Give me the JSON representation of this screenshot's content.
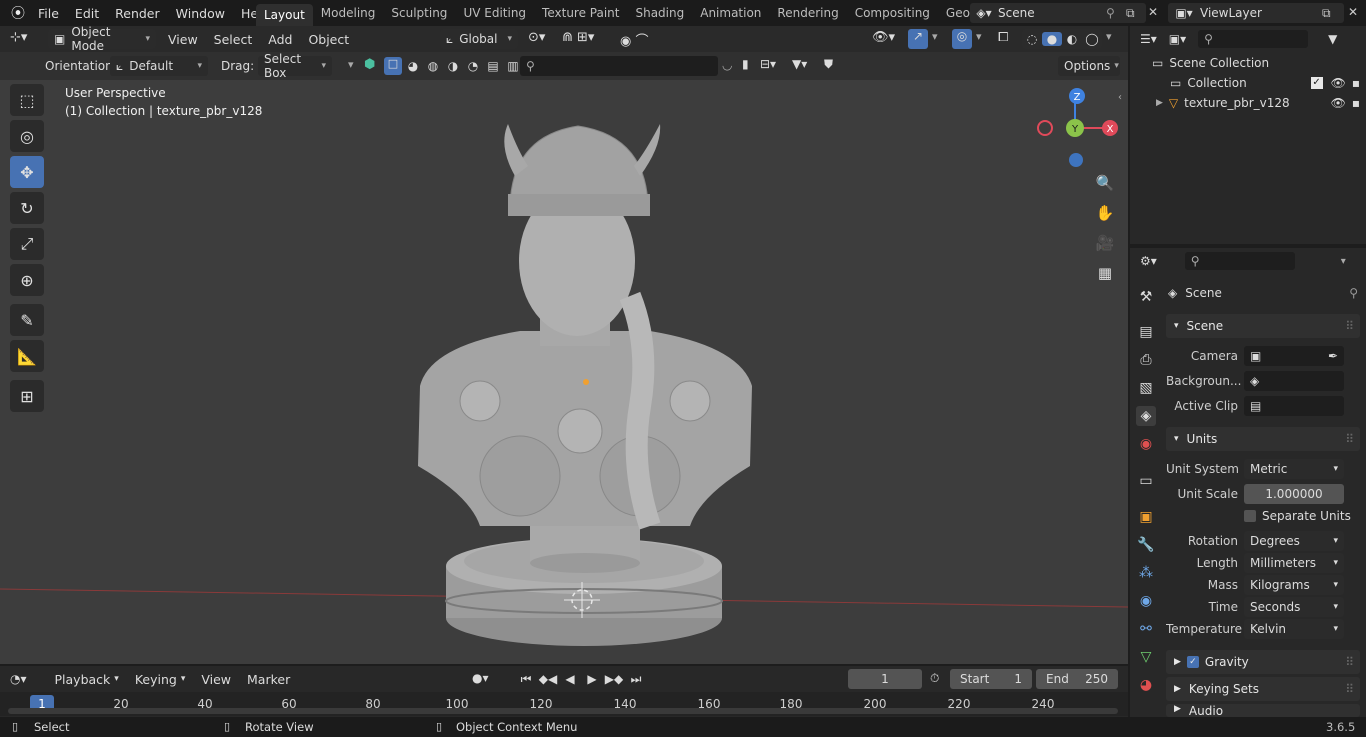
{
  "topbar": {
    "menus": [
      "File",
      "Edit",
      "Render",
      "Window",
      "Help"
    ],
    "workspaces": [
      "Layout",
      "Modeling",
      "Sculpting",
      "UV Editing",
      "Texture Paint",
      "Shading",
      "Animation",
      "Rendering",
      "Compositing",
      "Geometry Noc"
    ],
    "active_workspace": "Layout",
    "scene": "Scene",
    "view_layer": "ViewLayer"
  },
  "viewport_header": {
    "mode": "Object Mode",
    "menus": [
      "View",
      "Select",
      "Add",
      "Object"
    ],
    "transform_orientation": "Global",
    "orientation_label": "Orientation:",
    "orientation_value": "Default",
    "drag_label": "Drag:",
    "drag_value": "Select Box",
    "options": "Options"
  },
  "viewport": {
    "view_name": "User Perspective",
    "collection_info": "(1) Collection | texture_pbr_v128",
    "gizmo_axes": {
      "x": "X",
      "y": "Y",
      "z": "Z"
    }
  },
  "outliner": {
    "root": "Scene Collection",
    "items": [
      {
        "label": "Collection"
      },
      {
        "label": "texture_pbr_v128"
      }
    ]
  },
  "properties": {
    "context_title": "Scene",
    "scene_panel": {
      "title": "Scene",
      "camera_label": "Camera",
      "background_label": "Backgroun...",
      "active_clip_label": "Active Clip"
    },
    "units_panel": {
      "title": "Units",
      "unit_system_label": "Unit System",
      "unit_system": "Metric",
      "unit_scale_label": "Unit Scale",
      "unit_scale": "1.000000",
      "separate_units": "Separate Units",
      "rotation_label": "Rotation",
      "rotation": "Degrees",
      "length_label": "Length",
      "length": "Millimeters",
      "mass_label": "Mass",
      "mass": "Kilograms",
      "time_label": "Time",
      "time": "Seconds",
      "temperature_label": "Temperature",
      "temperature": "Kelvin"
    },
    "gravity": "Gravity",
    "keying_sets": "Keying Sets",
    "audio": "Audio"
  },
  "timeline": {
    "menus": [
      "Playback",
      "Keying",
      "View",
      "Marker"
    ],
    "current_frame": "1",
    "start_label": "Start",
    "start": "1",
    "end_label": "End",
    "end": "250",
    "ruler": [
      "1",
      "20",
      "40",
      "60",
      "80",
      "100",
      "120",
      "140",
      "160",
      "180",
      "200",
      "220",
      "240"
    ]
  },
  "statusbar": {
    "select": "Select",
    "rotate": "Rotate View",
    "context": "Object Context Menu",
    "version": "3.6.5"
  },
  "colors": {
    "accent": "#4772b3",
    "x_axis": "#e04a5a",
    "y_axis": "#8bc34a",
    "z_axis": "#3f82e0"
  }
}
